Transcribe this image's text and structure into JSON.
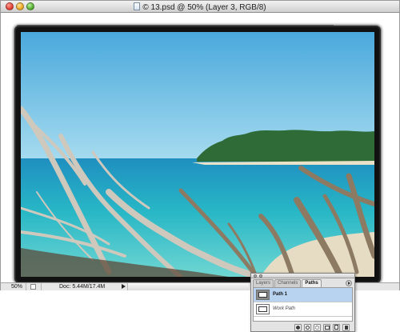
{
  "window": {
    "title": "© 13.psd @ 50% (Layer 3, RGB/8)",
    "buttons": [
      "close",
      "minimize",
      "zoom"
    ]
  },
  "canvas": {
    "image": "beach-photo-with-driftwood",
    "colors": {
      "sky": "#5fb6df",
      "sea": "#1fb0c2",
      "island": "#2c6a3a",
      "frame": "#111111"
    }
  },
  "status": {
    "zoom": "50%",
    "doc_info": "Doc: 5.44M/17.4M"
  },
  "paths_palette": {
    "tabs": [
      {
        "label": "Layers",
        "active": false
      },
      {
        "label": "Channels",
        "active": false
      },
      {
        "label": "Paths",
        "active": true
      }
    ],
    "paths": [
      {
        "name": "Path 1",
        "selected": true
      },
      {
        "name": "Work Path",
        "selected": false
      }
    ],
    "footer_buttons": [
      "fill-path-icon",
      "stroke-path-icon",
      "load-selection-icon",
      "make-work-path-icon",
      "new-path-icon",
      "delete-path-icon"
    ]
  }
}
